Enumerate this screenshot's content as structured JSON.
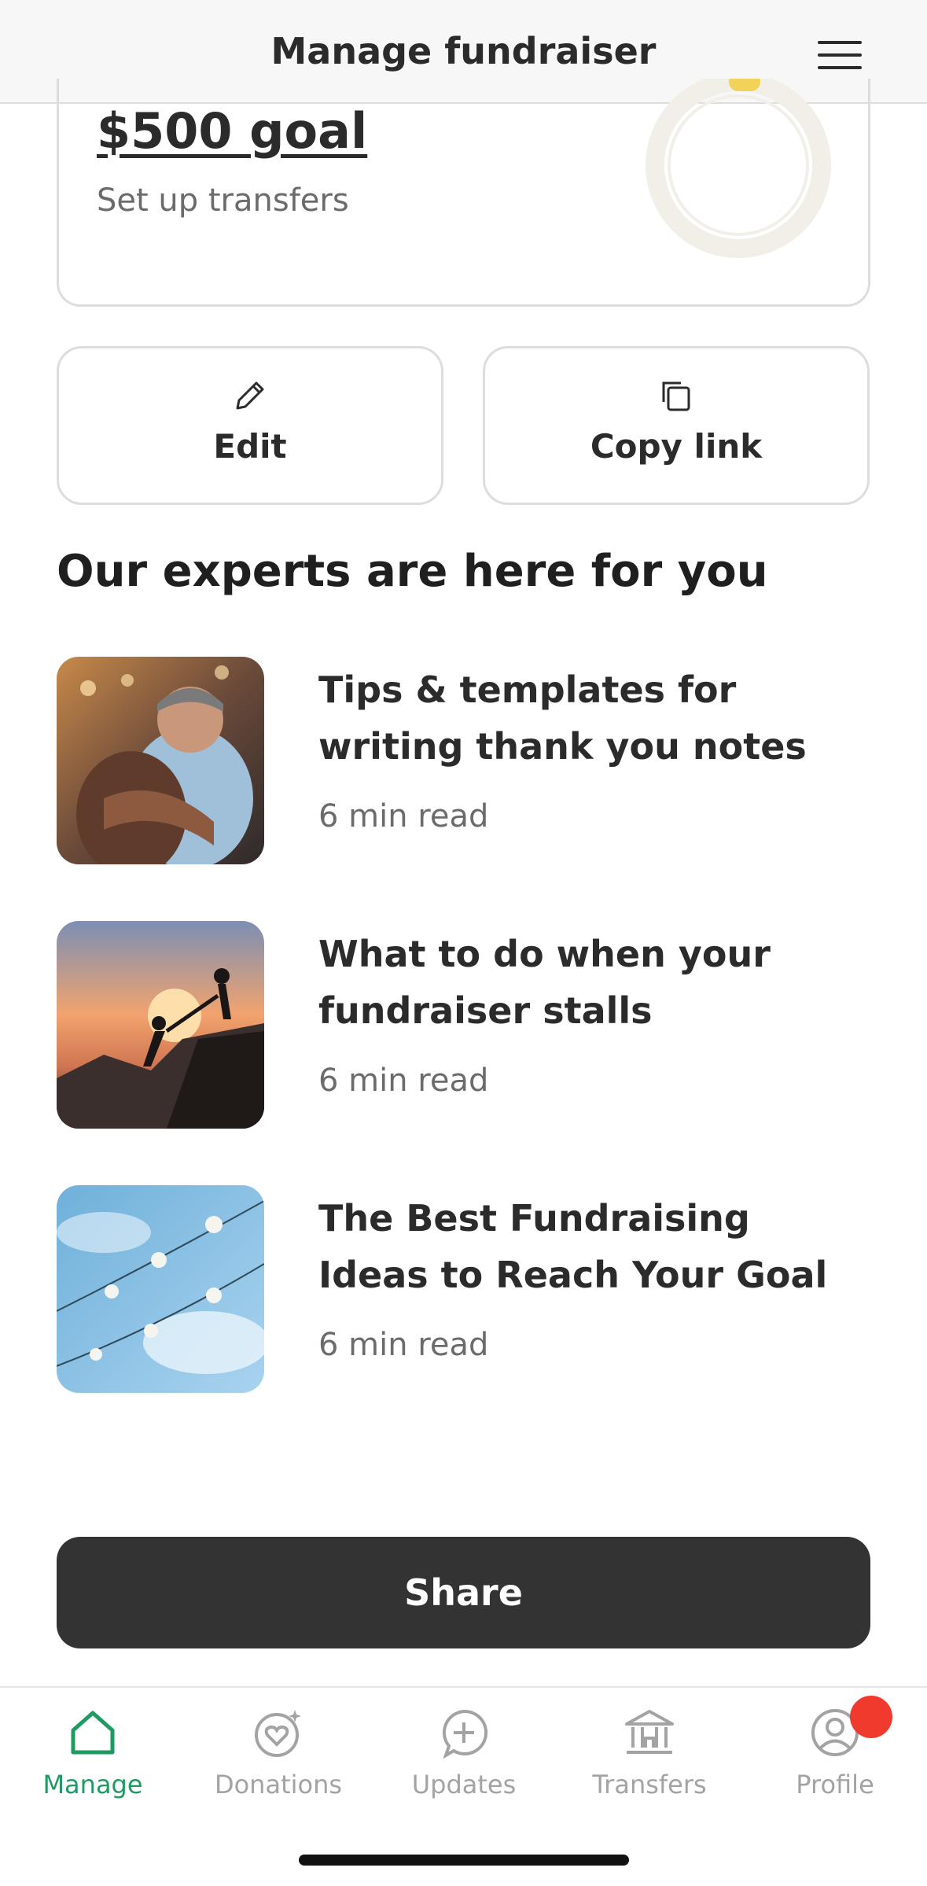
{
  "header": {
    "title": "Manage fundraiser"
  },
  "goal": {
    "amount": "$500 goal",
    "subtitle": "Set up transfers"
  },
  "actions": {
    "edit": "Edit",
    "copy_link": "Copy link"
  },
  "experts": {
    "title": "Our experts are here for you",
    "articles": [
      {
        "title": "Tips & templates for writing thank you notes",
        "read_time": "6 min read"
      },
      {
        "title": "What to do when your fundraiser stalls",
        "read_time": "6 min read"
      },
      {
        "title": "The Best Fundraising Ideas to Reach Your Goal",
        "read_time": "6 min read"
      }
    ]
  },
  "share": {
    "label": "Share"
  },
  "tabbar": {
    "items": [
      {
        "label": "Manage",
        "icon": "home-icon",
        "active": true
      },
      {
        "label": "Donations",
        "icon": "heart-sparkle-icon"
      },
      {
        "label": "Updates",
        "icon": "plus-bubble-icon"
      },
      {
        "label": "Transfers",
        "icon": "bank-icon"
      },
      {
        "label": "Profile",
        "icon": "user-circle-icon"
      }
    ]
  },
  "colors": {
    "accent": "#1f9b62",
    "share_bg": "#333333",
    "badge": "#f03a2e",
    "ring_progress": "#f2d35a"
  }
}
